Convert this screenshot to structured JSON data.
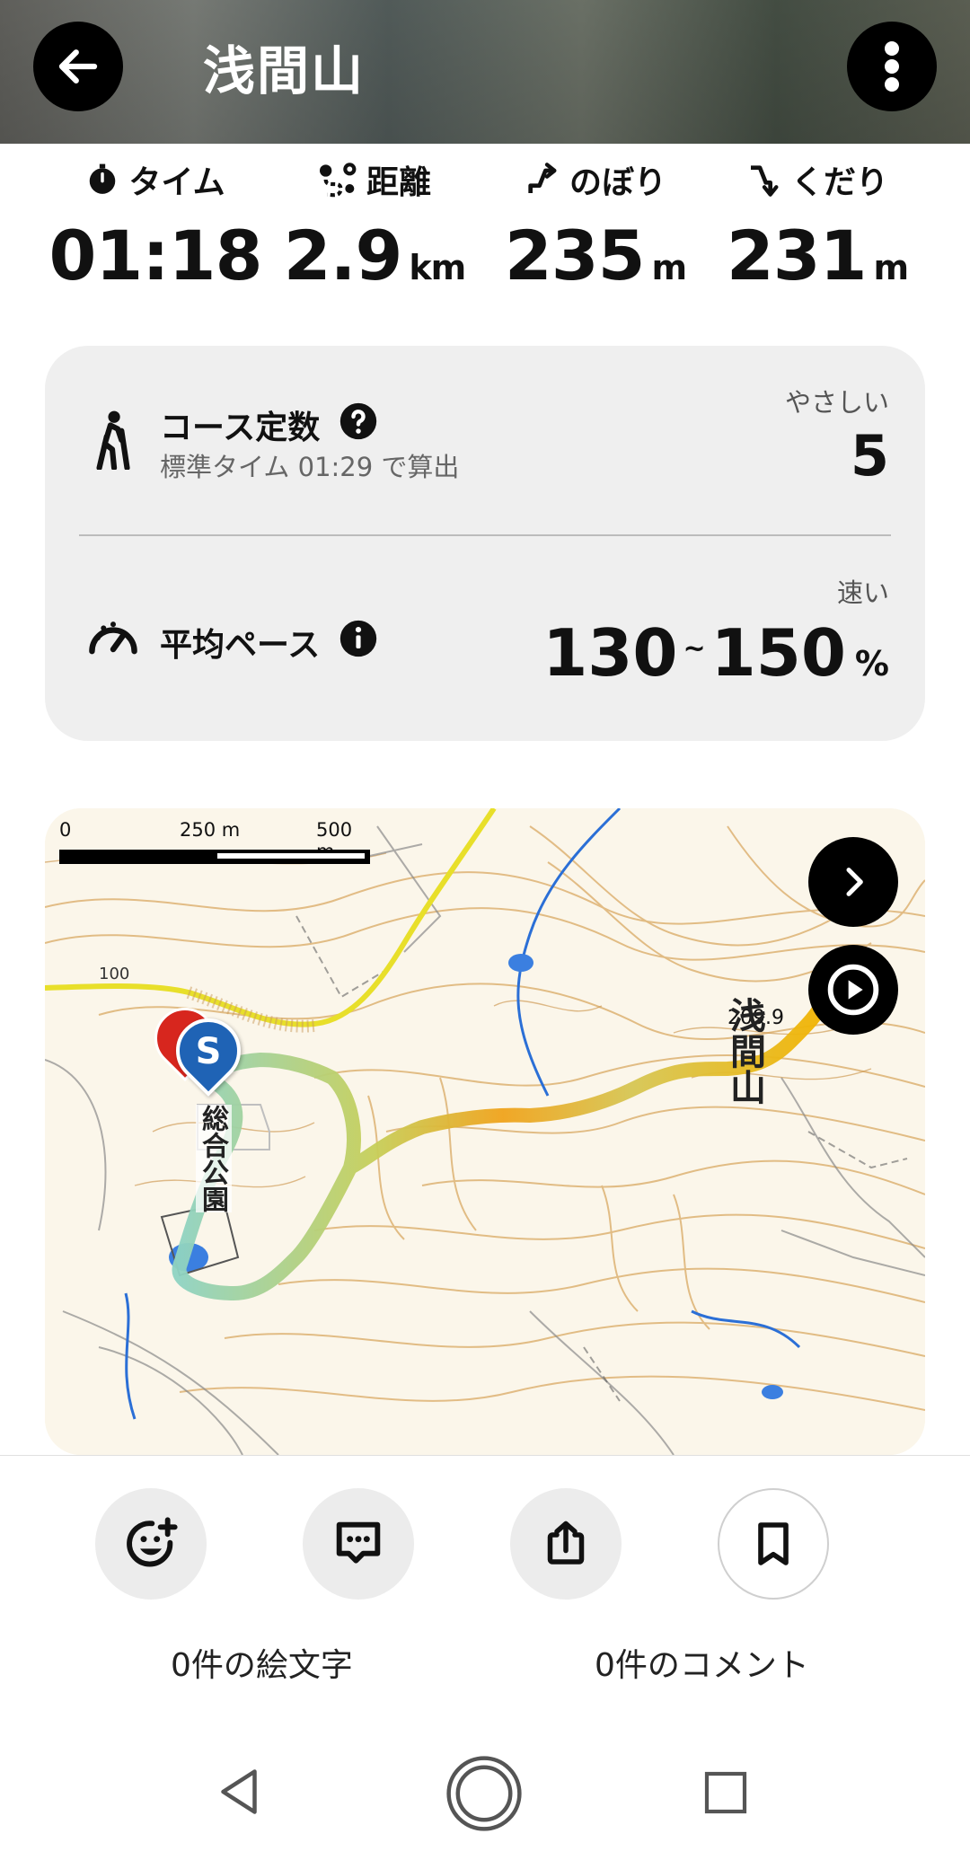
{
  "header": {
    "title": "浅間山",
    "back_icon": "arrow-left-icon",
    "menu_icon": "more-vertical-icon"
  },
  "stats": [
    {
      "label": "タイム",
      "value": "01:18",
      "unit": "",
      "icon": "stopwatch-icon"
    },
    {
      "label": "距離",
      "value": "2.9",
      "unit": "km",
      "icon": "route-icon"
    },
    {
      "label": "のぼり",
      "value": "235",
      "unit": "m",
      "icon": "ascent-icon"
    },
    {
      "label": "くだり",
      "value": "231",
      "unit": "m",
      "icon": "descent-icon"
    }
  ],
  "course": {
    "title": "コース定数",
    "subtitle": "標準タイム 01:29 で算出",
    "level": "やさしい",
    "value": "5"
  },
  "pace": {
    "title": "平均ペース",
    "level": "速い",
    "low": "130",
    "tilde": "~",
    "high": "150",
    "unit": "%"
  },
  "map": {
    "scale_labels": [
      "0",
      "250 m",
      "500 m"
    ],
    "peak_name": "浅間山",
    "peak_elev": "209.9",
    "park_name": "総合公園",
    "start_marker": "S",
    "map_label_left": "100"
  },
  "actions": {
    "emoji_label": "0件の絵文字",
    "comment_label": "0件のコメント"
  },
  "colors": {
    "card_bg": "#efefef",
    "map_contour": "#d7a45a",
    "road": "#e8df2a",
    "accent_blue": "#1f63b5",
    "track_start": "#8fd3c2",
    "track_end": "#f2a900"
  }
}
